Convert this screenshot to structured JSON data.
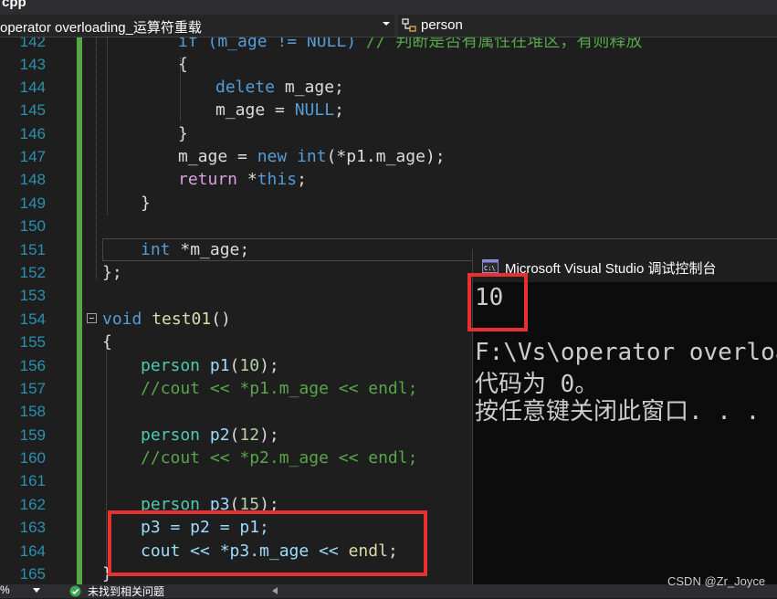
{
  "file_tab": {
    "label": "cpp"
  },
  "nav": {
    "scope": "operator overloading_运算符重载",
    "member": "person"
  },
  "line_numbers": [
    "142",
    "143",
    "144",
    "145",
    "146",
    "147",
    "148",
    "149",
    "150",
    "151",
    "152",
    "153",
    "154",
    "155",
    "156",
    "157",
    "158",
    "159",
    "160",
    "161",
    "162",
    "163",
    "164",
    "165"
  ],
  "code": {
    "l142": {
      "a": "if (m_age != NULL) ",
      "b": "// 判断是否有属性在堆区，有则释放"
    },
    "l143": "{",
    "l144": {
      "kw": "delete",
      "rest": " m_age;"
    },
    "l145": {
      "a": "m_age = ",
      "kw": "NULL",
      "b": ";"
    },
    "l146": "}",
    "l147": {
      "a": "m_age = ",
      "kw": "new",
      "sp": " ",
      "ty": "int",
      "b": "(*p1.m_age);"
    },
    "l149": "}",
    "l148": {
      "kw": "return",
      "a": " *",
      "kw2": "this",
      "b": ";"
    },
    "l151": {
      "kw": "int",
      "b": " *m_age;"
    },
    "l152": "};",
    "l154": {
      "kw": "void",
      "fn": " test01",
      "b": "()"
    },
    "l155": "{",
    "l156": {
      "ty": "person",
      "vr": " p1",
      "a": "(",
      "nm": "10",
      "b": ");"
    },
    "l157": "//cout << *p1.m_age << endl;",
    "l159": {
      "ty": "person",
      "vr": " p2",
      "a": "(",
      "nm": "12",
      "b": ");"
    },
    "l160": "//cout << *p2.m_age << endl;",
    "l162": {
      "ty": "person",
      "vr": " p3",
      "a": "(",
      "nm": "15",
      "b": ");"
    },
    "l163": "p3 = p2 = p1;",
    "l164": {
      "a": "cout << *p3.m_age << ",
      "b": "endl",
      "c": ";"
    },
    "l165": "}"
  },
  "console": {
    "title": "Microsoft Visual Studio 调试控制台",
    "output_value": "10",
    "line1": "F:\\Vs\\operator overloa",
    "line2": "代码为 0。",
    "line3": "按任意键关闭此窗口. . ."
  },
  "status": {
    "zoom": "%",
    "message": "未找到相关问题"
  },
  "watermark": "CSDN @Zr_Joyce",
  "colors": {
    "background": "#1e1e1e",
    "line_number": "#2b91af",
    "keyword": "#569cd6",
    "type": "#4ec9b0",
    "comment": "#57a64a",
    "highlight_box": "#e8302e"
  }
}
